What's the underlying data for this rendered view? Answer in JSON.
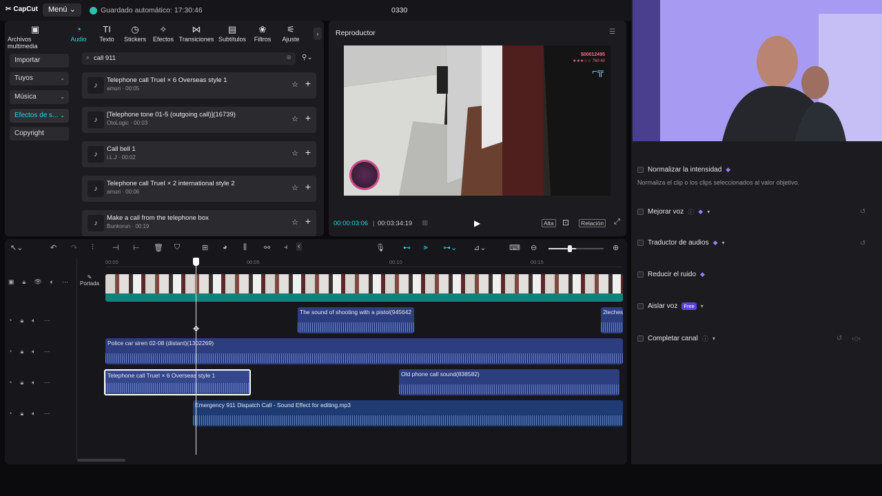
{
  "app": {
    "logo": "CapCut",
    "menu_label": "Menú",
    "autosave": "Guardado automático: 17:30:46",
    "project_title": "0330"
  },
  "toolbar": {
    "tabs": [
      {
        "label": "Archivos multimedia",
        "icon": "media-icon",
        "glyph": "▣"
      },
      {
        "label": "Audio",
        "icon": "audio-icon",
        "glyph": "◔"
      },
      {
        "label": "Texto",
        "icon": "text-icon",
        "glyph": "TI"
      },
      {
        "label": "Stickers",
        "icon": "sticker-icon",
        "glyph": "◷"
      },
      {
        "label": "Efectos",
        "icon": "effects-icon",
        "glyph": "✧"
      },
      {
        "label": "Transiciones",
        "icon": "transition-icon",
        "glyph": "⋈"
      },
      {
        "label": "Subtítulos",
        "icon": "subtitles-icon",
        "glyph": "▤"
      },
      {
        "label": "Filtros",
        "icon": "filters-icon",
        "glyph": "❀"
      },
      {
        "label": "Ajuste",
        "icon": "adjust-icon",
        "glyph": "⚟"
      }
    ]
  },
  "sidebar": {
    "items": [
      {
        "label": "Importar",
        "chevron": ""
      },
      {
        "label": "Tuyos",
        "chevron": "⌄"
      },
      {
        "label": "Música",
        "chevron": "⌄"
      },
      {
        "label": "Efectos de s...",
        "chevron": "⌄"
      },
      {
        "label": "Copyright",
        "chevron": ""
      }
    ]
  },
  "search": {
    "value": "call 911"
  },
  "results": [
    {
      "title": "Telephone call TrueI × 6 Overseas style 1",
      "meta": "amuri · 00:05"
    },
    {
      "title": "[Telephone tone 01-5 (outgoing call)](16739)",
      "meta": "OtoLogic · 00:03"
    },
    {
      "title": "Call bell 1",
      "meta": "i.L.J · 00:02"
    },
    {
      "title": "Telephone call TrueI × 2 international style 2",
      "meta": "amuri · 00:06"
    },
    {
      "title": "Make a call from the telephone box",
      "meta": "Bunkorun · 00:19"
    }
  ],
  "player": {
    "title": "Reproductor",
    "current": "00:00:03:06",
    "total": "00:03:34:19",
    "quality": "Alta",
    "ratio": "Relación",
    "hud_money": "$00012495",
    "hud_stars": "★★★☆☆ 760 40"
  },
  "timeline": {
    "ruler": [
      "00:00",
      "00:05",
      "00:10",
      "00:15"
    ],
    "cover_label": "Portada",
    "clips": {
      "shooting": "The sound of shooting with a pistol(945642",
      "leches": "2leches",
      "siren": "Police car siren 02-08 (distant)(1302269)",
      "telephone": "Telephone call TrueI × 6 Overseas style 1",
      "oldphone": "Old phone call sound(838582)",
      "emergency": "Emergency 911 Dispatch Call - Sound Effect for editing.mp3"
    }
  },
  "properties": {
    "normalize": {
      "label": "Normalizar la intensidad",
      "desc": "Normaliza el clip o los clips seleccionados al valor objetivo."
    },
    "enhance": "Mejorar voz",
    "translate": "Traductor de audios",
    "noise": "Reducir el ruido",
    "isolate": "Aislar voz",
    "isolate_badge": "Free",
    "channel": "Completar canal"
  },
  "colors": {
    "accent": "#2fd3e0",
    "audio_clip": "#2c3e80",
    "video_track": "#13807a"
  }
}
